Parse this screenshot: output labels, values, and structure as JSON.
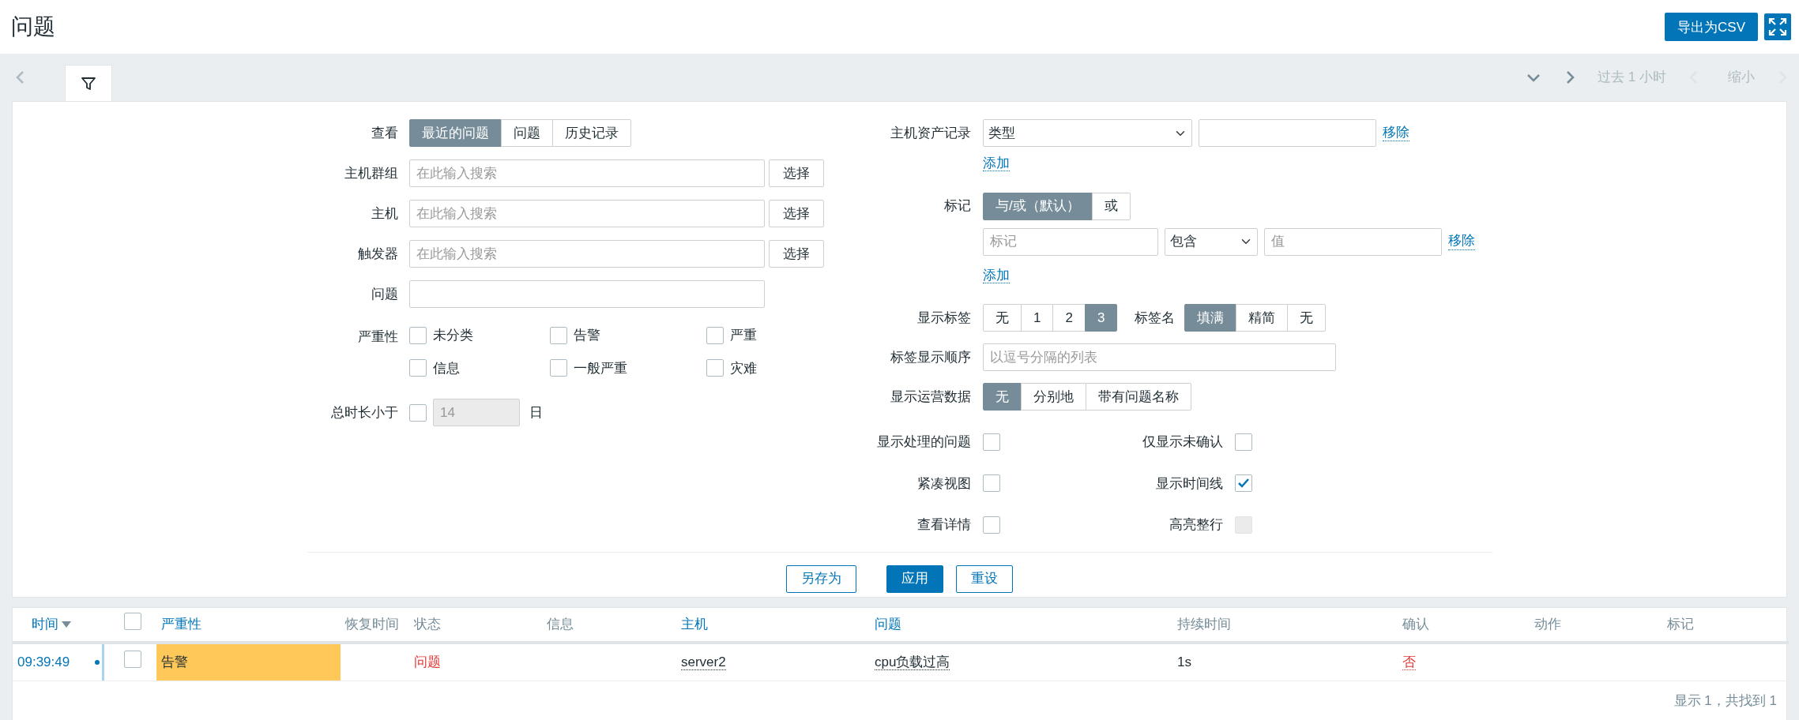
{
  "page": {
    "title": "问题",
    "export_button": "导出为CSV"
  },
  "tab_strip": {
    "filter_tab_selected": true,
    "time_range": "过去 1 小时",
    "zoom_out": "缩小"
  },
  "filter": {
    "view": {
      "label": "查看",
      "options": [
        {
          "label": "最近的问题",
          "selected": true
        },
        {
          "label": "问题",
          "selected": false
        },
        {
          "label": "历史记录",
          "selected": false
        }
      ]
    },
    "pickers": [
      {
        "label": "主机群组",
        "placeholder": "在此输入搜索",
        "button": "选择"
      },
      {
        "label": "主机",
        "placeholder": "在此输入搜索",
        "button": "选择"
      },
      {
        "label": "触发器",
        "placeholder": "在此输入搜索",
        "button": "选择"
      }
    ],
    "problem": {
      "label": "问题"
    },
    "severity": {
      "label": "严重性",
      "options": [
        {
          "label": "未分类",
          "checked": false
        },
        {
          "label": "告警",
          "checked": false
        },
        {
          "label": "严重",
          "checked": false
        },
        {
          "label": "信息",
          "checked": false
        },
        {
          "label": "一般严重",
          "checked": false
        },
        {
          "label": "灾难",
          "checked": false
        }
      ]
    },
    "age": {
      "label": "总时长小于",
      "checked": false,
      "value": "14",
      "unit": "日"
    },
    "inventory": {
      "label": "主机资产记录",
      "field": "类型",
      "remove": "移除",
      "add": "添加"
    },
    "tags": {
      "label": "标记",
      "operators": [
        {
          "label": "与/或（默认）",
          "selected": true
        },
        {
          "label": "或",
          "selected": false
        }
      ],
      "rows": [
        {
          "tag_placeholder": "标记",
          "operator": "包含",
          "value_placeholder": "值",
          "remove": "移除"
        }
      ],
      "add": "添加"
    },
    "show_tags": {
      "label": "显示标签",
      "options": [
        {
          "label": "无",
          "selected": false
        },
        {
          "label": "1",
          "selected": false
        },
        {
          "label": "2",
          "selected": false
        },
        {
          "label": "3",
          "selected": true
        }
      ]
    },
    "tag_name": {
      "label": "标签名",
      "options": [
        {
          "label": "填满",
          "selected": true
        },
        {
          "label": "精简",
          "selected": false
        },
        {
          "label": "无",
          "selected": false
        }
      ]
    },
    "tag_priority": {
      "label": "标签显示顺序",
      "placeholder": "以逗号分隔的列表"
    },
    "show_opdata": {
      "label": "显示运营数据",
      "options": [
        {
          "label": "无",
          "selected": true
        },
        {
          "label": "分别地",
          "selected": false
        },
        {
          "label": "带有问题名称",
          "selected": false
        }
      ]
    },
    "flags": [
      {
        "label": "显示处理的问题",
        "checked": false,
        "disabled": false
      },
      {
        "label": "仅显示未确认",
        "checked": false,
        "disabled": false
      },
      {
        "label": "紧凑视图",
        "checked": false,
        "disabled": false
      },
      {
        "label": "显示时间线",
        "checked": true,
        "disabled": false
      },
      {
        "label": "查看详情",
        "checked": false,
        "disabled": false
      },
      {
        "label": "高亮整行",
        "checked": false,
        "disabled": true
      }
    ],
    "buttons": [
      {
        "label": "另存为",
        "kind": "outline"
      },
      {
        "label": "应用",
        "kind": "primary"
      },
      {
        "label": "重设",
        "kind": "outline"
      }
    ]
  },
  "table": {
    "columns": [
      {
        "label": "时间",
        "sortable": true,
        "sorted": true
      },
      {
        "kind": "checkbox",
        "checked": false
      },
      {
        "label": "严重性",
        "sortable": true
      },
      {
        "label": "恢复时间",
        "sortable": false
      },
      {
        "label": "状态",
        "sortable": false
      },
      {
        "label": "信息",
        "sortable": false
      },
      {
        "label": "主机",
        "sortable": true
      },
      {
        "label": "问题",
        "sortable": true
      },
      {
        "label": "持续时间",
        "sortable": false
      },
      {
        "label": "确认",
        "sortable": false
      },
      {
        "label": "动作",
        "sortable": false
      },
      {
        "label": "标记",
        "sortable": false
      }
    ],
    "rows": [
      {
        "time": "09:39:49",
        "selected": false,
        "severity": "告警",
        "color": "#ffc859",
        "status": "问题",
        "host": "server2",
        "problem": "cpu负载过高",
        "duration": "1s",
        "ack": "否"
      }
    ],
    "footer": "显示 1，共找到 1"
  }
}
